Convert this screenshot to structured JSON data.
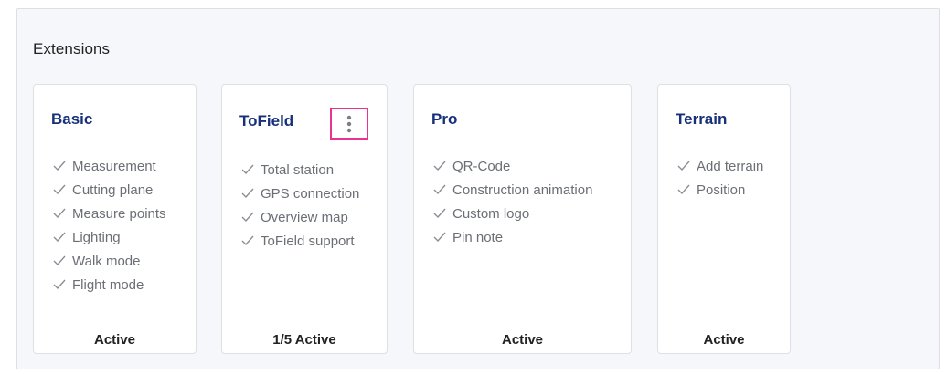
{
  "section": {
    "title": "Extensions"
  },
  "cards": [
    {
      "title": "Basic",
      "features": [
        "Measurement",
        "Cutting plane",
        "Measure points",
        "Lighting",
        "Walk mode",
        "Flight mode"
      ],
      "status": "Active"
    },
    {
      "title": "ToField",
      "features": [
        "Total station",
        "GPS connection",
        "Overview map",
        "ToField support"
      ],
      "status": "1/5 Active",
      "menu_icon": "more-vertical-icon"
    },
    {
      "title": "Pro",
      "features": [
        "QR-Code",
        "Construction animation",
        "Custom logo",
        "Pin note"
      ],
      "status": "Active"
    },
    {
      "title": "Terrain",
      "features": [
        "Add terrain",
        "Position"
      ],
      "status": "Active"
    }
  ],
  "colors": {
    "title": "#17307a",
    "feature_text": "#6b6f75",
    "highlight": "#e8338f",
    "panel_bg": "#f6f7fa"
  }
}
